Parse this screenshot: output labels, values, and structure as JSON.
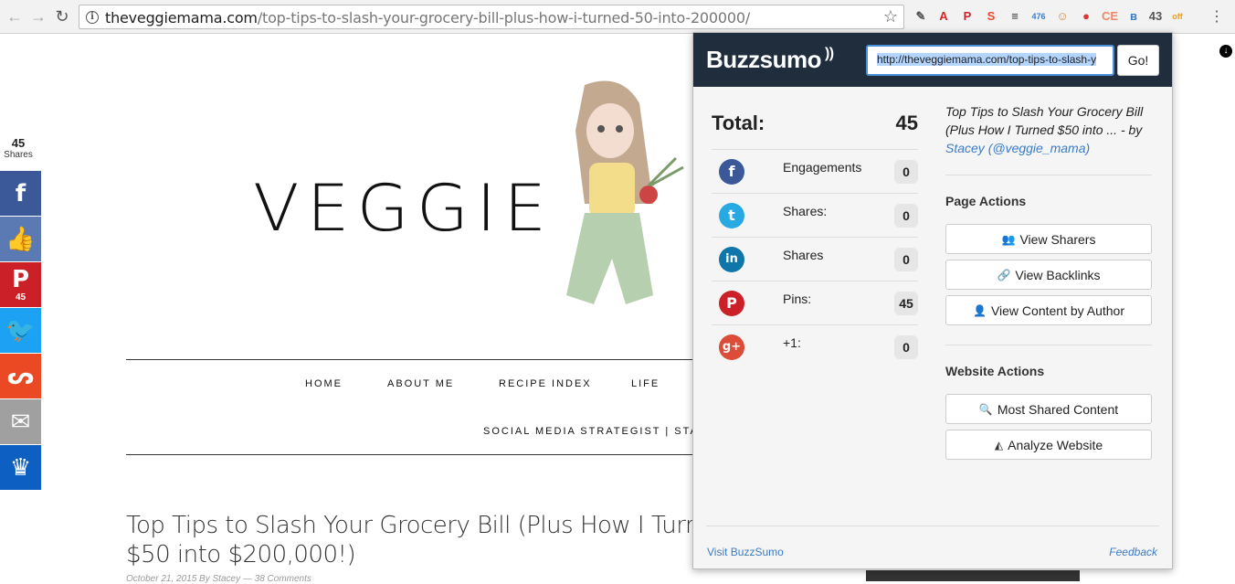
{
  "browser": {
    "url_host": "theveggiemama.com",
    "url_path": "/top-tips-to-slash-your-grocery-bill-plus-how-i-turned-50-into-200000/",
    "extensions": [
      {
        "name": "evernote-icon",
        "glyph": "✎",
        "color": "#555"
      },
      {
        "name": "acrobat-icon",
        "glyph": "A",
        "color": "#d22"
      },
      {
        "name": "pinterest-ext-icon",
        "glyph": "P",
        "color": "#c8232c"
      },
      {
        "name": "stumbleupon-ext-icon",
        "glyph": "S",
        "color": "#eb4924"
      },
      {
        "name": "buffer-ext-icon",
        "glyph": "≡",
        "color": "#333"
      },
      {
        "name": "ext-476-icon",
        "glyph": "476",
        "color": "#3a7bc8"
      },
      {
        "name": "face-ext-icon",
        "glyph": "☺",
        "color": "#c84"
      },
      {
        "name": "tomato-ext-icon",
        "glyph": "●",
        "color": "#d33"
      },
      {
        "name": "ce-ext-icon",
        "glyph": "CE",
        "color": "#e86"
      },
      {
        "name": "buzzsumo-ext-icon",
        "glyph": "ʙ",
        "color": "#3a7bc8"
      },
      {
        "name": "ext-43-icon",
        "glyph": "43",
        "color": "#555"
      },
      {
        "name": "off-ext-icon",
        "glyph": "off",
        "color": "#e9a020"
      }
    ]
  },
  "sidebar": {
    "total": "45",
    "total_label": "Shares",
    "buttons": [
      {
        "name": "facebook-share-button",
        "glyph": "f",
        "color": "#3b5998",
        "count": ""
      },
      {
        "name": "like-share-button",
        "glyph": "👍",
        "color": "#5b7ab4",
        "count": ""
      },
      {
        "name": "pinterest-share-button",
        "glyph": "P",
        "color": "#cb2027",
        "count": "45"
      },
      {
        "name": "twitter-share-button",
        "glyph": "🐦",
        "color": "#1da1f2",
        "count": ""
      },
      {
        "name": "stumbleupon-share-button",
        "glyph": "ᔕ",
        "color": "#eb4924",
        "count": ""
      },
      {
        "name": "email-share-button",
        "glyph": "✉",
        "color": "#a0a0a0",
        "count": ""
      },
      {
        "name": "sumome-share-button",
        "glyph": "♛",
        "color": "#0e5fc2",
        "count": ""
      }
    ]
  },
  "site": {
    "logo_text": "VEGGIE",
    "menu": [
      "HOME",
      "ABOUT ME",
      "RECIPE INDEX",
      "LIFE"
    ],
    "menu2": "SOCIAL MEDIA STRATEGIST | STAC",
    "post_title_line1": "Top Tips to Slash Your Grocery Bill (Plus How I Turne",
    "post_title_line2": "$50 into $200,000!)",
    "post_meta": "October 21, 2015 By Stacey — 38 Comments"
  },
  "popup": {
    "logo": "Buzzsumo",
    "url_value": "http://theveggiemama.com/top-tips-to-slash-y",
    "go_label": "Go!",
    "total_label": "Total:",
    "total_value": "45",
    "networks": [
      {
        "name": "facebook",
        "glyph": "f",
        "color": "#3b5998",
        "label": "Engagements",
        "value": "0"
      },
      {
        "name": "twitter",
        "glyph": "t",
        "color": "#29a9e1",
        "label": "Shares:",
        "value": "0"
      },
      {
        "name": "linkedin",
        "glyph": "in",
        "color": "#0e76a8",
        "label": "Shares",
        "value": "0"
      },
      {
        "name": "pinterest",
        "glyph": "P",
        "color": "#cb2027",
        "label": "Pins:",
        "value": "45"
      },
      {
        "name": "googleplus",
        "glyph": "g+",
        "color": "#dd4b39",
        "label": "+1:",
        "value": "0"
      }
    ],
    "article_title": "Top Tips to Slash Your Grocery Bill (Plus How I Turned $50 into ... - by",
    "article_author": "Stacey (@veggie_mama)",
    "page_actions_heading": "Page Actions",
    "page_actions": [
      "View Sharers",
      "View Backlinks",
      "View Content by Author"
    ],
    "website_actions_heading": "Website Actions",
    "website_actions": [
      "Most Shared Content",
      "Analyze Website"
    ],
    "footer_left": "Visit BuzzSumo",
    "footer_right": "Feedback"
  }
}
